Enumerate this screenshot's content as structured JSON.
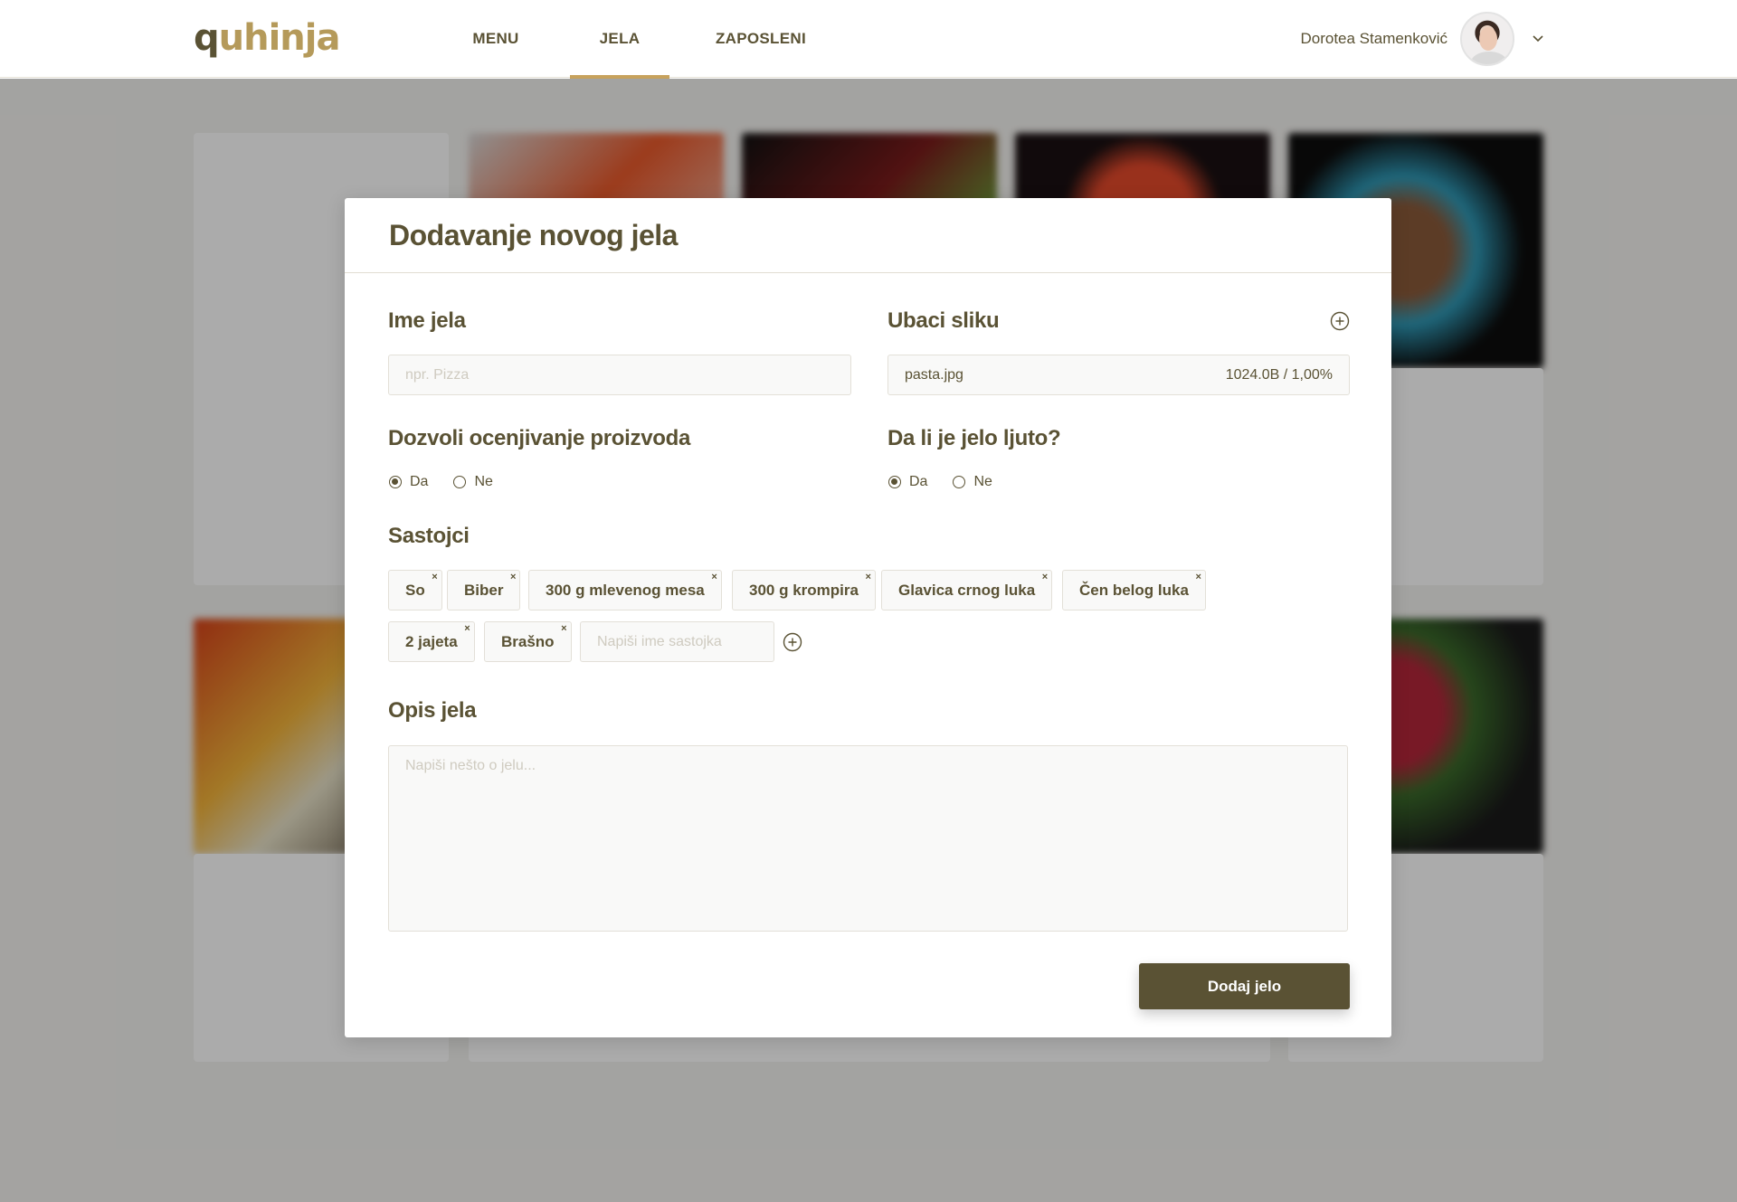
{
  "header": {
    "logo_q": "q",
    "logo_rest": "uhinja",
    "nav": [
      {
        "label": "MENU",
        "active": false
      },
      {
        "label": "JELA",
        "active": true
      },
      {
        "label": "ZAPOSLENI",
        "active": false
      }
    ],
    "user_name": "Dorotea Stamenković",
    "avatar_icon": "user-avatar",
    "dropdown_icon": "chevron-down-icon"
  },
  "modal": {
    "title": "Dodavanje novog jela",
    "name_field": {
      "label": "Ime jela",
      "placeholder": "npr. Pizza",
      "value": ""
    },
    "image_field": {
      "label": "Ubaci sliku",
      "filename": "pasta.jpg",
      "progress": "1024.0B / 1,00%",
      "add_icon": "plus-circle-icon"
    },
    "rating": {
      "label": "Dozvoli ocenjivanje proizvoda",
      "options": [
        "Da",
        "Ne"
      ],
      "selected": "Da"
    },
    "spicy": {
      "label": "Da li je jelo ljuto?",
      "options": [
        "Da",
        "Ne"
      ],
      "selected": "Da"
    },
    "ingredients": {
      "label": "Sastojci",
      "items": [
        "So",
        "Biber",
        "300 g mlevenog mesa",
        "300 g krompira",
        "Glavica crnog luka",
        "Čen belog luka",
        "2 jajeta",
        "Brašno"
      ],
      "input_placeholder": "Napiši ime sastojka",
      "remove_glyph": "×"
    },
    "description": {
      "label": "Opis jela",
      "placeholder": "Napiši nešto o jelu..."
    },
    "submit_label": "Dodaj jelo"
  },
  "colors": {
    "primary": "#5a5234",
    "accent": "#c7a25d",
    "logo_accent": "#b59a5a"
  }
}
